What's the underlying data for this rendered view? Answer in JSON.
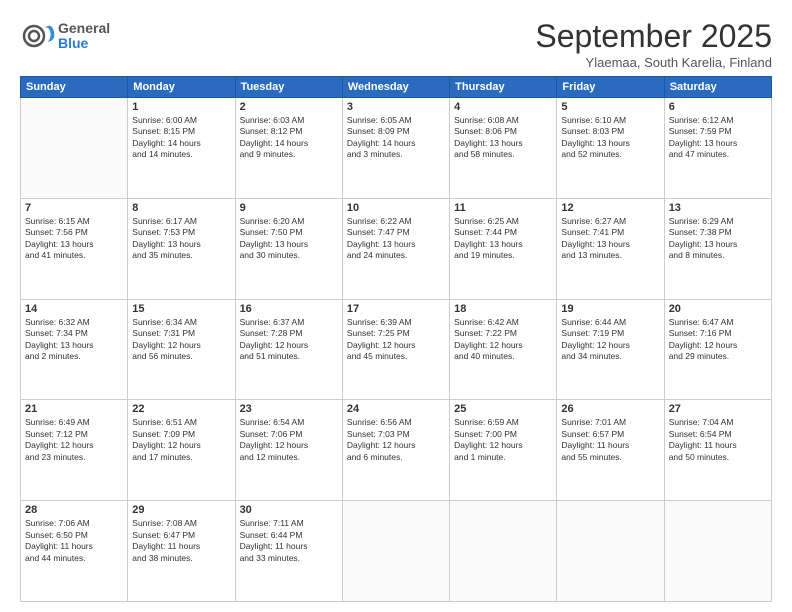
{
  "logo": {
    "line1": "General",
    "line2": "Blue"
  },
  "header": {
    "month": "September 2025",
    "location": "Ylaemaa, South Karelia, Finland"
  },
  "weekdays": [
    "Sunday",
    "Monday",
    "Tuesday",
    "Wednesday",
    "Thursday",
    "Friday",
    "Saturday"
  ],
  "weeks": [
    [
      {
        "day": "",
        "text": ""
      },
      {
        "day": "1",
        "text": "Sunrise: 6:00 AM\nSunset: 8:15 PM\nDaylight: 14 hours\nand 14 minutes."
      },
      {
        "day": "2",
        "text": "Sunrise: 6:03 AM\nSunset: 8:12 PM\nDaylight: 14 hours\nand 9 minutes."
      },
      {
        "day": "3",
        "text": "Sunrise: 6:05 AM\nSunset: 8:09 PM\nDaylight: 14 hours\nand 3 minutes."
      },
      {
        "day": "4",
        "text": "Sunrise: 6:08 AM\nSunset: 8:06 PM\nDaylight: 13 hours\nand 58 minutes."
      },
      {
        "day": "5",
        "text": "Sunrise: 6:10 AM\nSunset: 8:03 PM\nDaylight: 13 hours\nand 52 minutes."
      },
      {
        "day": "6",
        "text": "Sunrise: 6:12 AM\nSunset: 7:59 PM\nDaylight: 13 hours\nand 47 minutes."
      }
    ],
    [
      {
        "day": "7",
        "text": "Sunrise: 6:15 AM\nSunset: 7:56 PM\nDaylight: 13 hours\nand 41 minutes."
      },
      {
        "day": "8",
        "text": "Sunrise: 6:17 AM\nSunset: 7:53 PM\nDaylight: 13 hours\nand 35 minutes."
      },
      {
        "day": "9",
        "text": "Sunrise: 6:20 AM\nSunset: 7:50 PM\nDaylight: 13 hours\nand 30 minutes."
      },
      {
        "day": "10",
        "text": "Sunrise: 6:22 AM\nSunset: 7:47 PM\nDaylight: 13 hours\nand 24 minutes."
      },
      {
        "day": "11",
        "text": "Sunrise: 6:25 AM\nSunset: 7:44 PM\nDaylight: 13 hours\nand 19 minutes."
      },
      {
        "day": "12",
        "text": "Sunrise: 6:27 AM\nSunset: 7:41 PM\nDaylight: 13 hours\nand 13 minutes."
      },
      {
        "day": "13",
        "text": "Sunrise: 6:29 AM\nSunset: 7:38 PM\nDaylight: 13 hours\nand 8 minutes."
      }
    ],
    [
      {
        "day": "14",
        "text": "Sunrise: 6:32 AM\nSunset: 7:34 PM\nDaylight: 13 hours\nand 2 minutes."
      },
      {
        "day": "15",
        "text": "Sunrise: 6:34 AM\nSunset: 7:31 PM\nDaylight: 12 hours\nand 56 minutes."
      },
      {
        "day": "16",
        "text": "Sunrise: 6:37 AM\nSunset: 7:28 PM\nDaylight: 12 hours\nand 51 minutes."
      },
      {
        "day": "17",
        "text": "Sunrise: 6:39 AM\nSunset: 7:25 PM\nDaylight: 12 hours\nand 45 minutes."
      },
      {
        "day": "18",
        "text": "Sunrise: 6:42 AM\nSunset: 7:22 PM\nDaylight: 12 hours\nand 40 minutes."
      },
      {
        "day": "19",
        "text": "Sunrise: 6:44 AM\nSunset: 7:19 PM\nDaylight: 12 hours\nand 34 minutes."
      },
      {
        "day": "20",
        "text": "Sunrise: 6:47 AM\nSunset: 7:16 PM\nDaylight: 12 hours\nand 29 minutes."
      }
    ],
    [
      {
        "day": "21",
        "text": "Sunrise: 6:49 AM\nSunset: 7:12 PM\nDaylight: 12 hours\nand 23 minutes."
      },
      {
        "day": "22",
        "text": "Sunrise: 6:51 AM\nSunset: 7:09 PM\nDaylight: 12 hours\nand 17 minutes."
      },
      {
        "day": "23",
        "text": "Sunrise: 6:54 AM\nSunset: 7:06 PM\nDaylight: 12 hours\nand 12 minutes."
      },
      {
        "day": "24",
        "text": "Sunrise: 6:56 AM\nSunset: 7:03 PM\nDaylight: 12 hours\nand 6 minutes."
      },
      {
        "day": "25",
        "text": "Sunrise: 6:59 AM\nSunset: 7:00 PM\nDaylight: 12 hours\nand 1 minute."
      },
      {
        "day": "26",
        "text": "Sunrise: 7:01 AM\nSunset: 6:57 PM\nDaylight: 11 hours\nand 55 minutes."
      },
      {
        "day": "27",
        "text": "Sunrise: 7:04 AM\nSunset: 6:54 PM\nDaylight: 11 hours\nand 50 minutes."
      }
    ],
    [
      {
        "day": "28",
        "text": "Sunrise: 7:06 AM\nSunset: 6:50 PM\nDaylight: 11 hours\nand 44 minutes."
      },
      {
        "day": "29",
        "text": "Sunrise: 7:08 AM\nSunset: 6:47 PM\nDaylight: 11 hours\nand 38 minutes."
      },
      {
        "day": "30",
        "text": "Sunrise: 7:11 AM\nSunset: 6:44 PM\nDaylight: 11 hours\nand 33 minutes."
      },
      {
        "day": "",
        "text": ""
      },
      {
        "day": "",
        "text": ""
      },
      {
        "day": "",
        "text": ""
      },
      {
        "day": "",
        "text": ""
      }
    ]
  ]
}
